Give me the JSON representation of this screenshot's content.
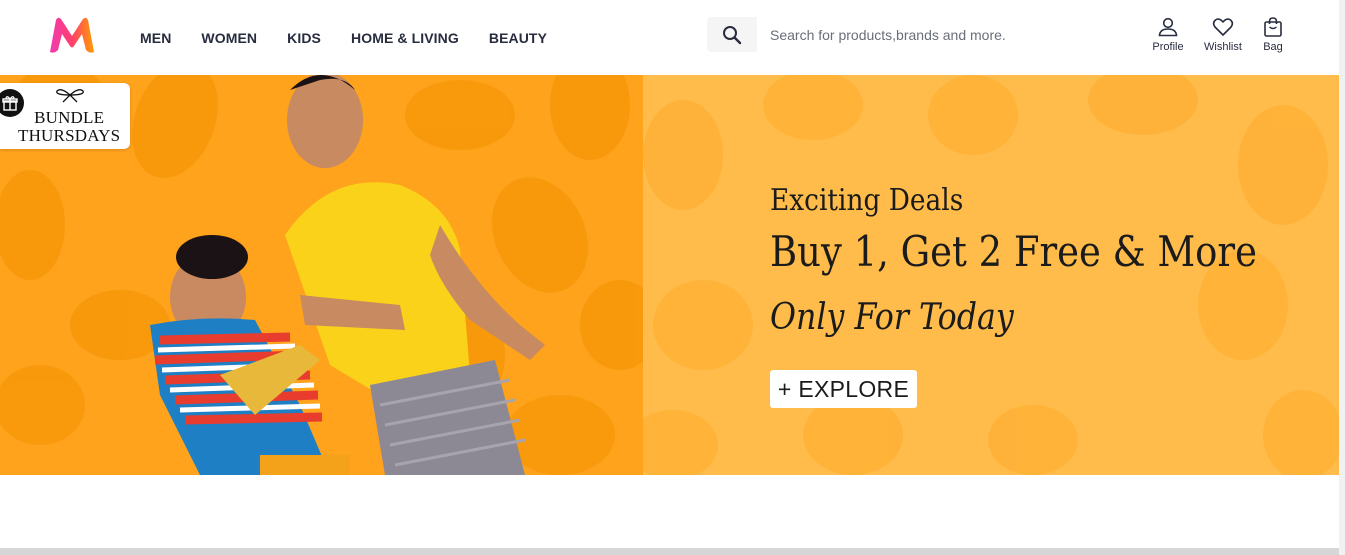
{
  "brand": {
    "logo_name": "myntra-logo",
    "colors": {
      "primary": "#ff3f6c",
      "secondary": "#f13ab1",
      "accent": "#ff9d00"
    }
  },
  "nav": {
    "items": [
      {
        "label": "MEN"
      },
      {
        "label": "WOMEN"
      },
      {
        "label": "KIDS"
      },
      {
        "label": "HOME & LIVING"
      },
      {
        "label": "BEAUTY"
      }
    ]
  },
  "search": {
    "placeholder": "Search for products,brands and more.",
    "value": "",
    "icon": "search-icon"
  },
  "actions": {
    "profile": {
      "label": "Profile",
      "icon": "profile-icon"
    },
    "wishlist": {
      "label": "Wishlist",
      "icon": "heart-icon"
    },
    "bag": {
      "label": "Bag",
      "icon": "bag-icon"
    }
  },
  "banner": {
    "badge": {
      "line1": "BUNDLE",
      "line2": "THURSDAYS",
      "icon": "gift-icon"
    },
    "headline_1": "Exciting Deals",
    "headline_2": "Buy 1, Get 2 Free & More",
    "headline_3": "Only For Today",
    "cta": "+ EXPLORE",
    "colors": {
      "left_bg": "#ffa21c",
      "right_bg": "#ffbc4a"
    }
  }
}
